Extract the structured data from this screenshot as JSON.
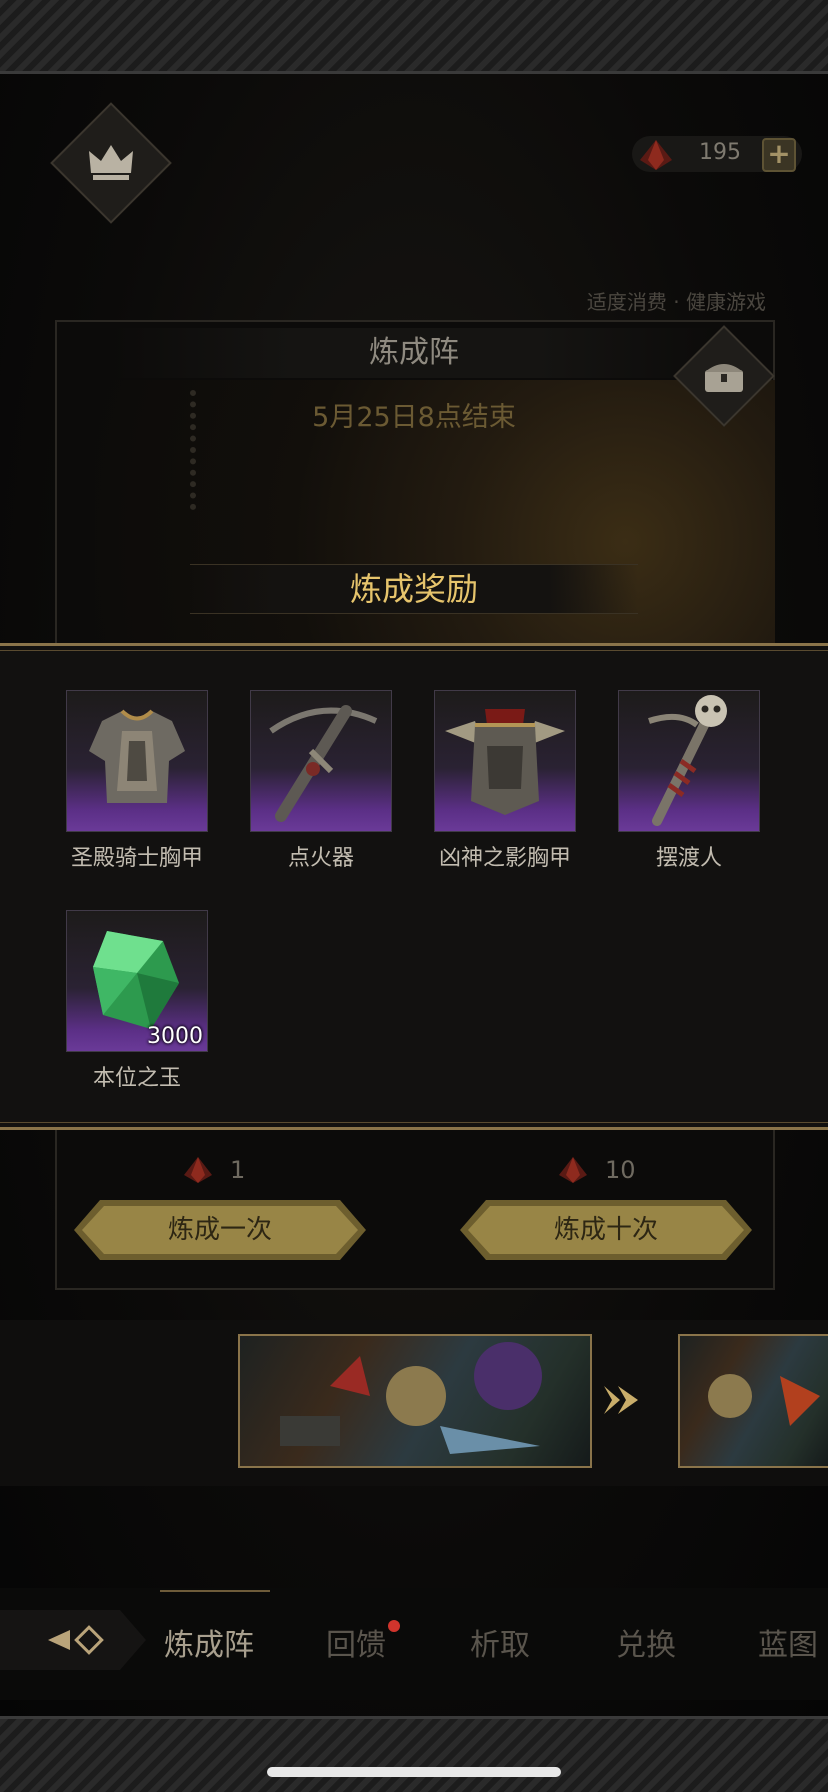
{
  "header": {
    "currency": {
      "icon": "red-crystal-icon",
      "amount": "195",
      "add_label": "+"
    },
    "crown_icon": "crown-icon"
  },
  "notice": "适度消费 · 健康游戏",
  "panel": {
    "title": "炼成阵",
    "end_date": "5月25日8点结束",
    "chest_icon": "chest-icon"
  },
  "rewards": {
    "title": "炼成奖励",
    "items": [
      {
        "name": "圣殿骑士胸甲",
        "icon": "chest-armor-icon",
        "qty": ""
      },
      {
        "name": "点火器",
        "icon": "crossbow-icon",
        "qty": ""
      },
      {
        "name": "凶神之影胸甲",
        "icon": "spiked-armor-icon",
        "qty": ""
      },
      {
        "name": "摆渡人",
        "icon": "skull-staff-icon",
        "qty": ""
      },
      {
        "name": "本位之玉",
        "icon": "green-gem-icon",
        "qty": "3000"
      }
    ]
  },
  "actions": {
    "once": {
      "cost": "1",
      "label": "炼成一次"
    },
    "ten": {
      "cost": "10",
      "label": "炼成十次"
    }
  },
  "tabs": [
    {
      "label": "炼成阵",
      "active": true
    },
    {
      "label": "回馈",
      "badge": true
    },
    {
      "label": "析取"
    },
    {
      "label": "兑换"
    },
    {
      "label": "蓝图"
    }
  ],
  "colors": {
    "gold": "#e6c46c",
    "button": "#8f7c3e",
    "purple": "#6a3a98",
    "badge": "#d0342c"
  }
}
